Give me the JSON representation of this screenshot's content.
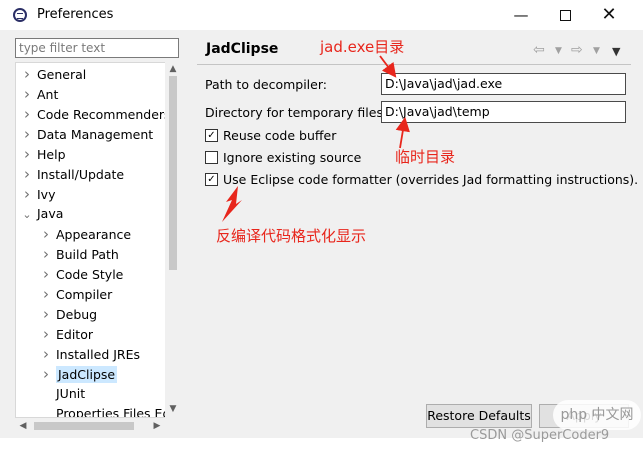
{
  "window": {
    "title": "Preferences",
    "min_glyph": "—",
    "close_glyph": "✕"
  },
  "sidebar": {
    "filter_placeholder": "type filter text",
    "items": [
      {
        "label": "General",
        "level": 0,
        "expanded": false
      },
      {
        "label": "Ant",
        "level": 0,
        "expanded": false
      },
      {
        "label": "Code Recommenders",
        "level": 0,
        "expanded": false
      },
      {
        "label": "Data Management",
        "level": 0,
        "expanded": false
      },
      {
        "label": "Help",
        "level": 0,
        "expanded": false
      },
      {
        "label": "Install/Update",
        "level": 0,
        "expanded": false
      },
      {
        "label": "Ivy",
        "level": 0,
        "expanded": false
      },
      {
        "label": "Java",
        "level": 0,
        "expanded": true
      },
      {
        "label": "Appearance",
        "level": 1,
        "expanded": false
      },
      {
        "label": "Build Path",
        "level": 1,
        "expanded": false
      },
      {
        "label": "Code Style",
        "level": 1,
        "expanded": false
      },
      {
        "label": "Compiler",
        "level": 1,
        "expanded": false
      },
      {
        "label": "Debug",
        "level": 1,
        "expanded": false
      },
      {
        "label": "Editor",
        "level": 1,
        "expanded": false
      },
      {
        "label": "Installed JREs",
        "level": 1,
        "expanded": false
      },
      {
        "label": "JadClipse",
        "level": 1,
        "expanded": false,
        "selected": true
      },
      {
        "label": "JUnit",
        "level": 1,
        "leaf": true
      },
      {
        "label": "Properties Files Ed",
        "level": 1,
        "leaf": true
      }
    ]
  },
  "page": {
    "title": "JadClipse",
    "path_label": "Path to decompiler:",
    "path_value": "D:\\Java\\jad\\jad.exe",
    "tempdir_label": "Directory for temporary files:",
    "tempdir_value": "D:\\Java\\jad\\temp",
    "reuse_label": "Reuse code buffer",
    "reuse_checked": true,
    "ignore_label": "Ignore existing source",
    "ignore_checked": false,
    "formatter_label": "Use Eclipse code formatter (overrides Jad formatting instructions).",
    "formatter_checked": true,
    "restore_label": "Restore Defaults",
    "apply_label": "Apply"
  },
  "annotations": {
    "decompiler": "jad.exe目录",
    "temp": "临时目录",
    "formatter": "反编译代码格式化显示",
    "color": "#e8261c"
  },
  "watermark": "CSDN @SuperCoder9",
  "badge": "php 中文网"
}
